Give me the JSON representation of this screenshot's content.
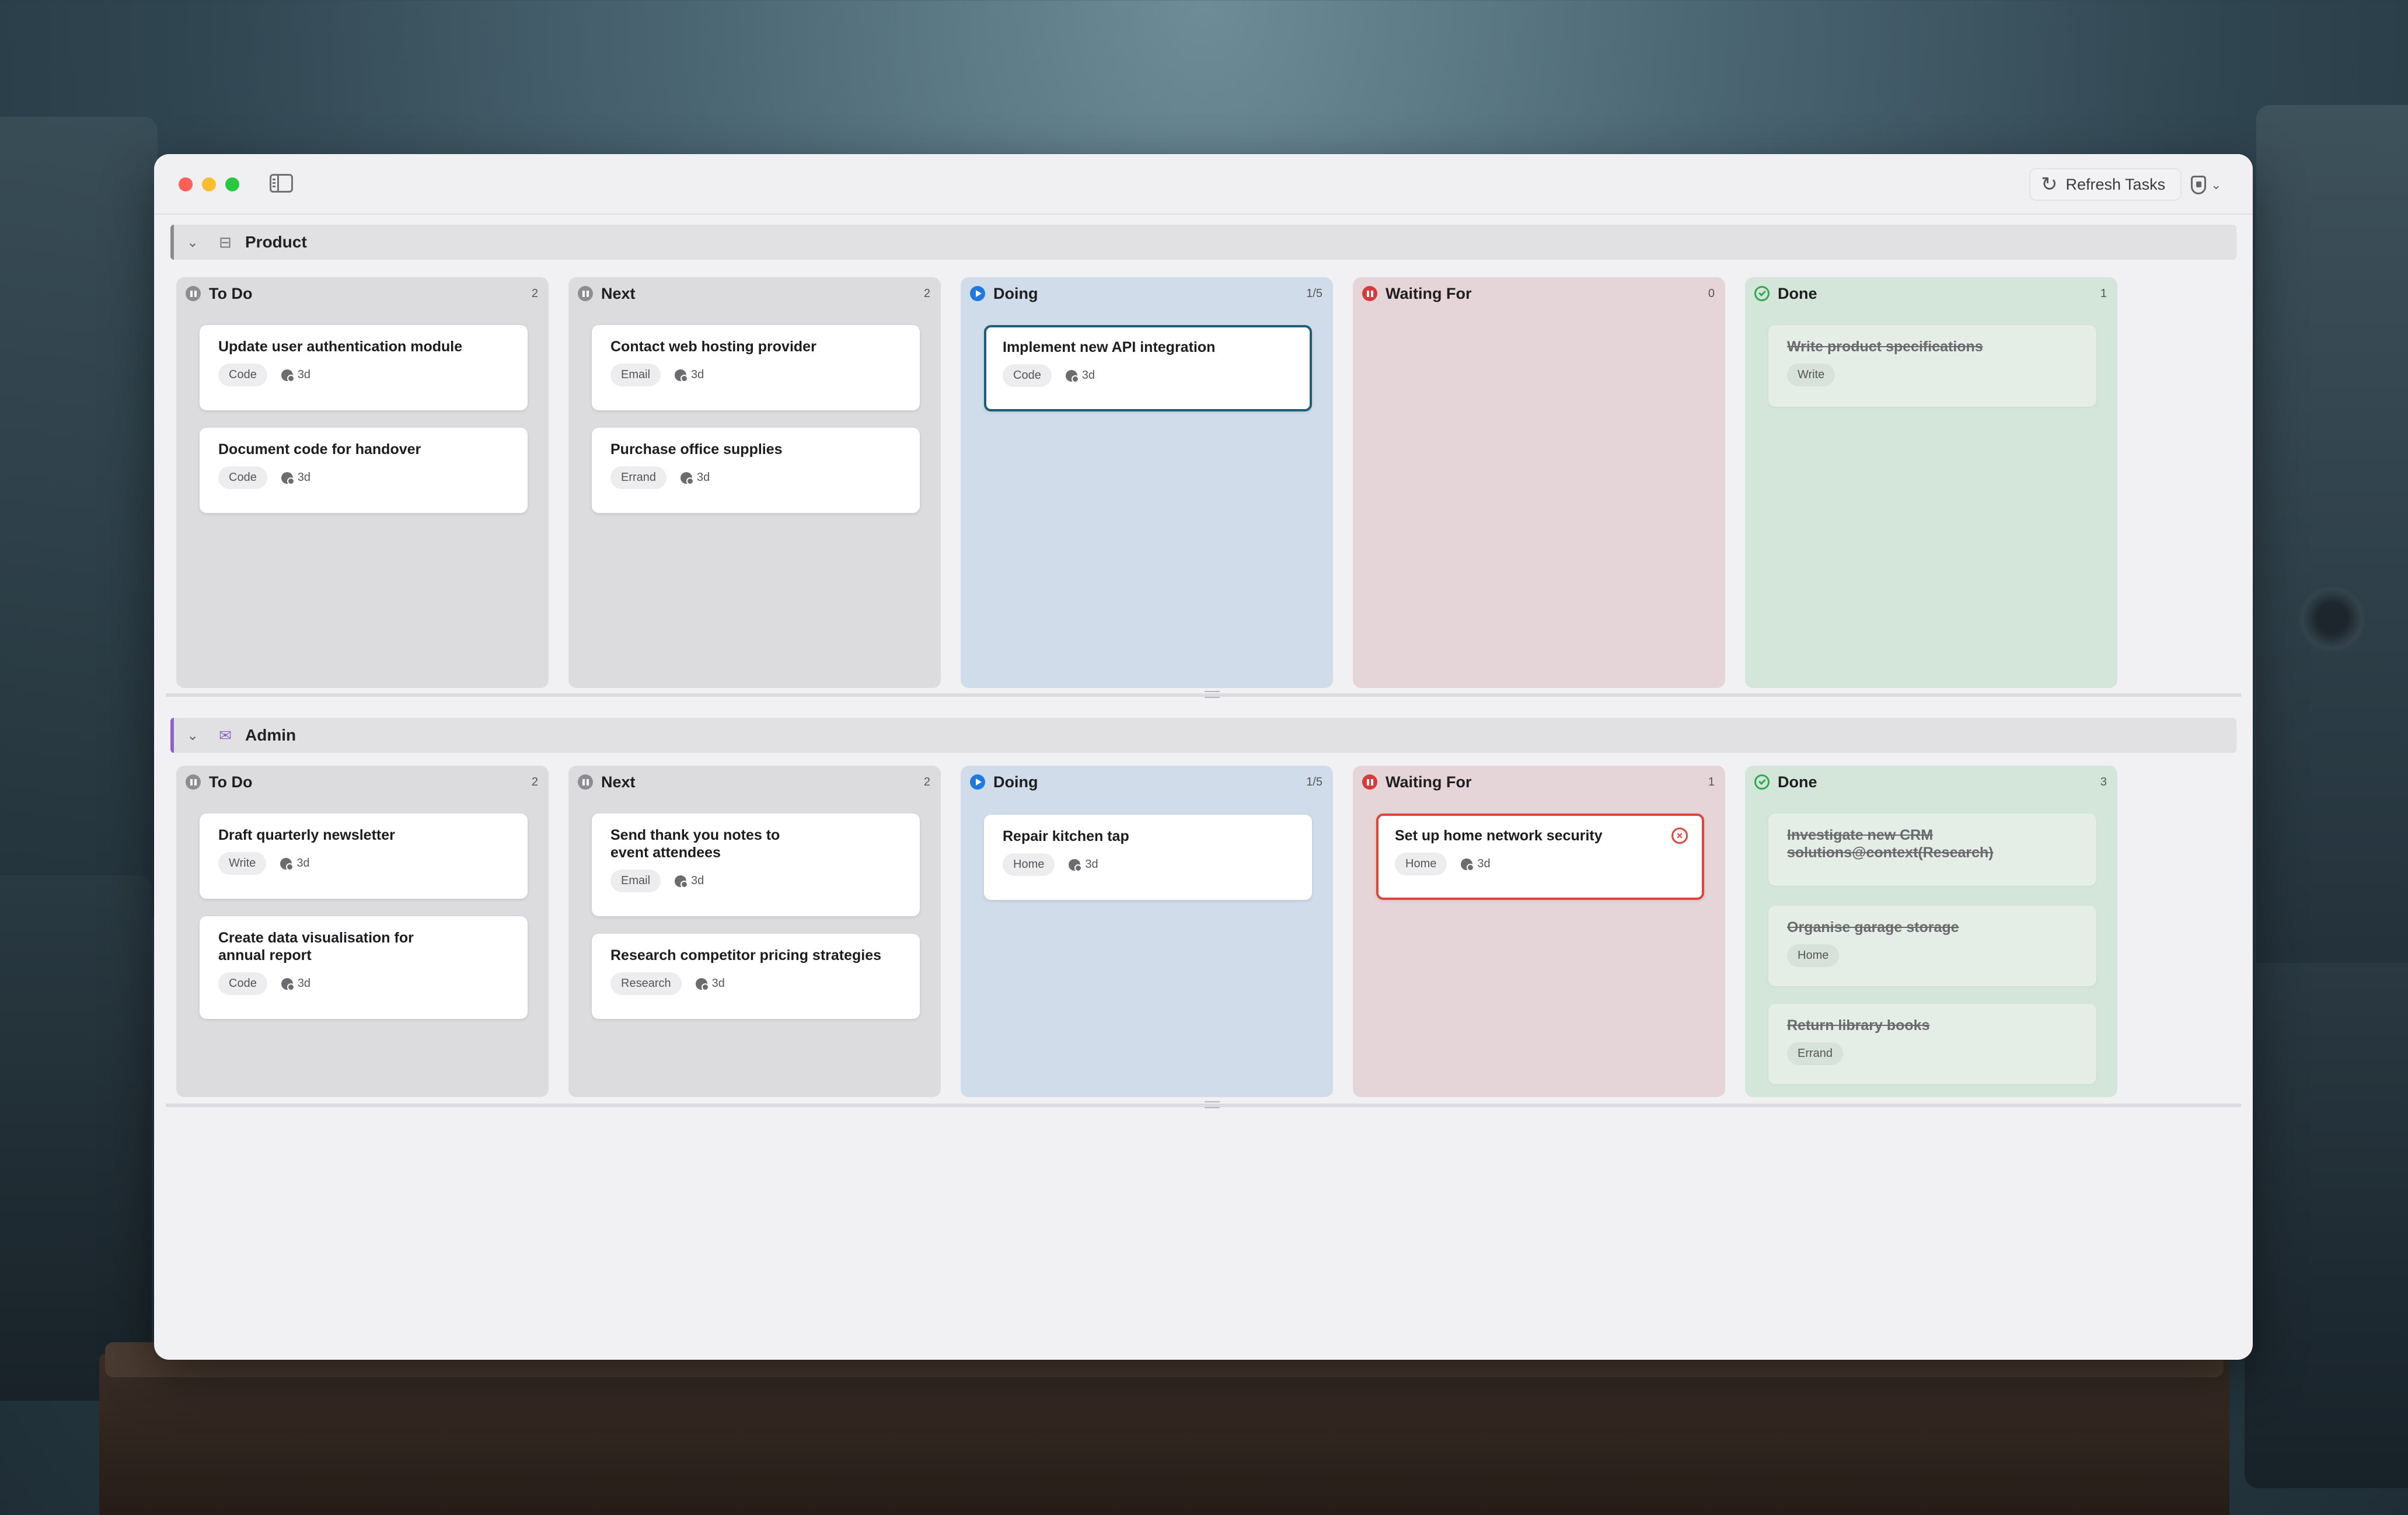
{
  "toolbar": {
    "refresh_label": "Refresh Tasks"
  },
  "boards": [
    {
      "title": "Product",
      "accent": "#8a8a8e",
      "columns": [
        {
          "title": "To Do",
          "count": "2",
          "status": "pause",
          "cards": [
            {
              "title": "Update user authentication module",
              "tag": "Code",
              "age": "3d"
            },
            {
              "title": "Document code for handover",
              "tag": "Code",
              "age": "3d"
            }
          ]
        },
        {
          "title": "Next",
          "count": "2",
          "status": "pause",
          "cards": [
            {
              "title": "Contact web hosting provider",
              "tag": "Email",
              "age": "3d"
            },
            {
              "title": "Purchase office supplies",
              "tag": "Errand",
              "age": "3d"
            }
          ]
        },
        {
          "title": "Doing",
          "count": "1/5",
          "status": "play",
          "cards": [
            {
              "title": "Implement new API integration",
              "tag": "Code",
              "age": "3d"
            }
          ]
        },
        {
          "title": "Waiting For",
          "count": "0",
          "status": "stop",
          "cards": []
        },
        {
          "title": "Done",
          "count": "1",
          "status": "check",
          "cards": [
            {
              "title": "Write product specifications",
              "tag": "Write"
            }
          ]
        }
      ]
    },
    {
      "title": "Admin",
      "accent": "#8e63c7",
      "columns": [
        {
          "title": "To Do",
          "count": "2",
          "status": "pause",
          "cards": [
            {
              "title": "Draft quarterly newsletter",
              "tag": "Write",
              "age": "3d"
            },
            {
              "title": "Create data visualisation for\nannual report",
              "tag": "Code",
              "age": "3d"
            }
          ]
        },
        {
          "title": "Next",
          "count": "2",
          "status": "pause",
          "cards": [
            {
              "title": "Send thank you notes to\nevent attendees",
              "tag": "Email",
              "age": "3d"
            },
            {
              "title": "Research competitor pricing strategies",
              "tag": "Research",
              "age": "3d"
            }
          ]
        },
        {
          "title": "Doing",
          "count": "1/5",
          "status": "play",
          "cards": [
            {
              "title": "Repair kitchen tap",
              "tag": "Home",
              "age": "3d"
            }
          ]
        },
        {
          "title": "Waiting For",
          "count": "1",
          "status": "stop",
          "cards": [
            {
              "title": "Set up home network security",
              "tag": "Home",
              "age": "3d"
            }
          ]
        },
        {
          "title": "Done",
          "count": "3",
          "status": "check",
          "cards": [
            {
              "title": "Investigate new CRM\nsolutions@context(Research)"
            },
            {
              "title": "Organise garage storage",
              "tag": "Home"
            },
            {
              "title": "Return library books",
              "tag": "Errand"
            }
          ]
        }
      ]
    }
  ]
}
